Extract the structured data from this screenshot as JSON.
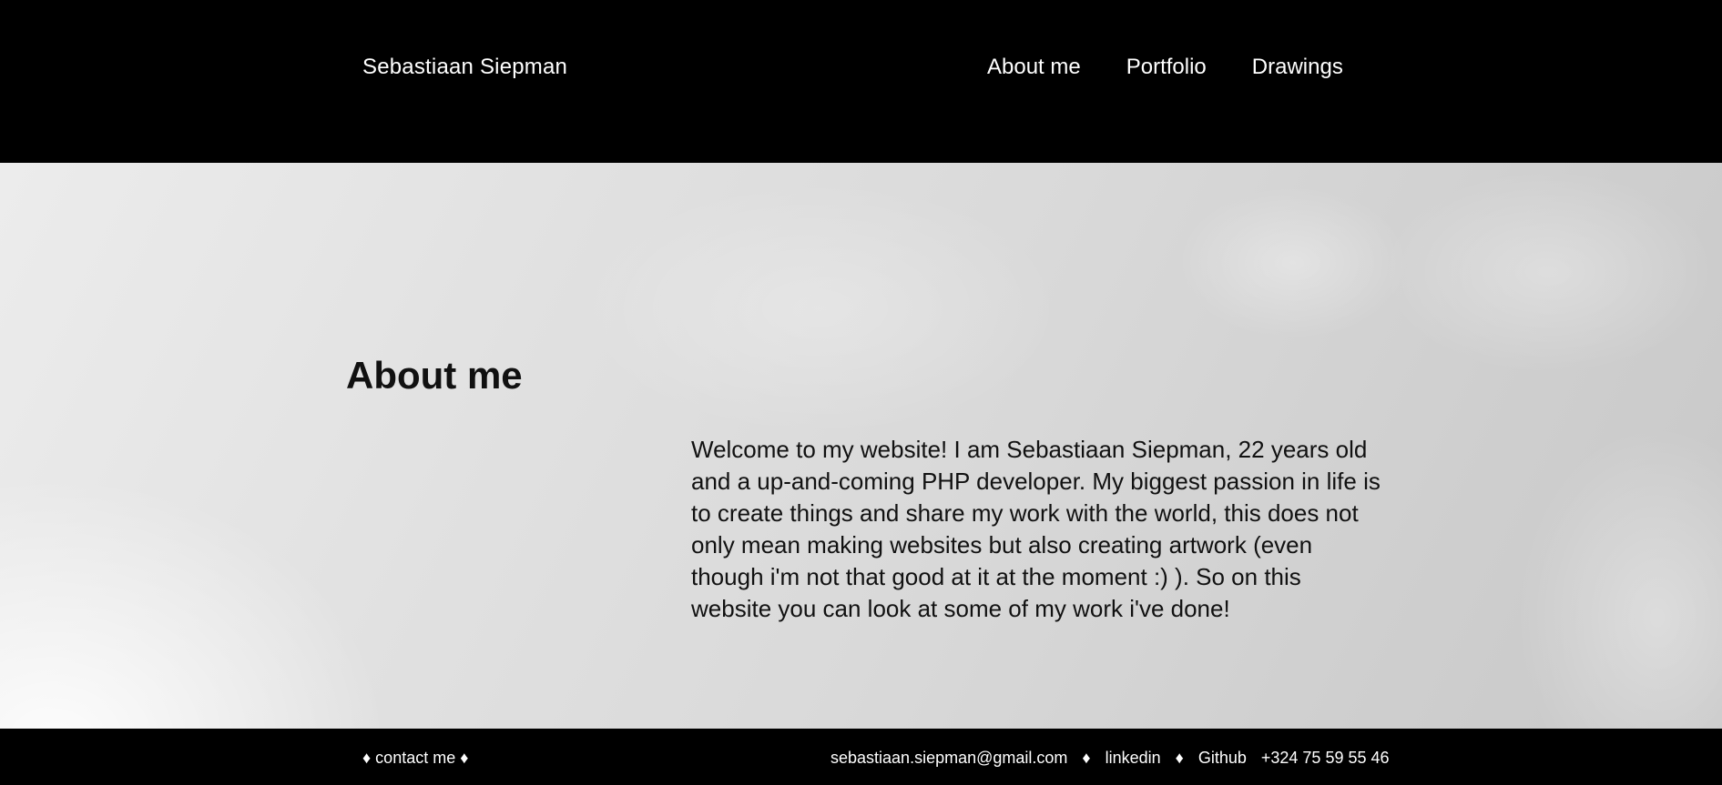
{
  "header": {
    "brand": "Sebastiaan Siepman",
    "nav": [
      {
        "label": "About me"
      },
      {
        "label": "Portfolio"
      },
      {
        "label": "Drawings"
      }
    ]
  },
  "hero": {
    "title": "About me",
    "text": "Welcome to my website! I am Sebastiaan Siepman, 22 years old and a up-and-coming PHP developer. My biggest passion in life is to create things and share my work with the world, this does not only mean making websites but also creating artwork (even though i'm not that good at it at the moment :) ). So on this website you can look at some of my work i've done!"
  },
  "footer": {
    "contact_title": "♦ contact me ♦",
    "email": "sebastiaan.siepman@gmail.com",
    "separator": "♦",
    "linkedin": "linkedin",
    "github": "Github",
    "phone": "+324 75 59 55 46"
  },
  "colors": {
    "header_bg": "#000000",
    "footer_bg": "#000000",
    "text_light": "#ffffff",
    "text_dark": "#111111"
  }
}
